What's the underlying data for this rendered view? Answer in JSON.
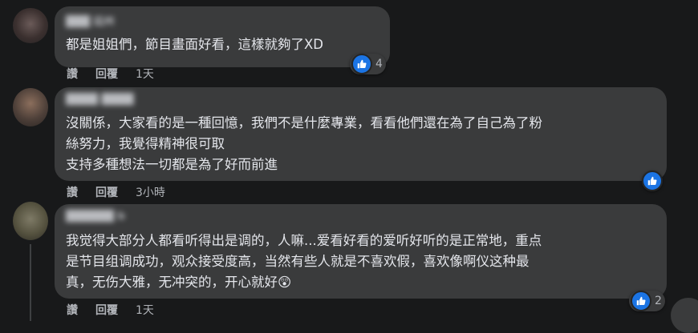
{
  "comments": [
    {
      "author": "███ 廷州",
      "lines": [
        "都是姐姐們，節目畫面好看，這樣就夠了XD"
      ],
      "reaction_count": "4",
      "actions": {
        "like": "讚",
        "reply": "回覆",
        "time": "1天"
      }
    },
    {
      "author": "████ ████",
      "lines": [
        "沒關係，大家看的是一種回憶，我們不是什麼專業，看看他們還在為了自己為了粉",
        "絲努力，我覺得精神很可取",
        "支持多種想法一切都是為了好而前進"
      ],
      "reaction_count": "",
      "actions": {
        "like": "讚",
        "reply": "回覆",
        "time": "3小時"
      }
    },
    {
      "author": "██████ b",
      "lines": [
        "我觉得大部分人都看听得出是调的，人嘛...爱看好看的爱听好听的是正常地，重点",
        "是节目组调成功，观众接受度高，当然有些人就是不喜欢假，喜欢像啊仪这种最",
        "真，无伤大雅，无冲突的，开心就好😲"
      ],
      "reaction_count": "2",
      "actions": {
        "like": "讚",
        "reply": "回覆",
        "time": "1天"
      }
    }
  ],
  "colors": {
    "background": "#18191a",
    "bubble": "#3a3b3c",
    "text": "#e4e6eb",
    "muted": "#b0b3b8",
    "like_blue": "#1b74e4"
  },
  "icons": {
    "reaction": "thumbs-up-icon"
  }
}
